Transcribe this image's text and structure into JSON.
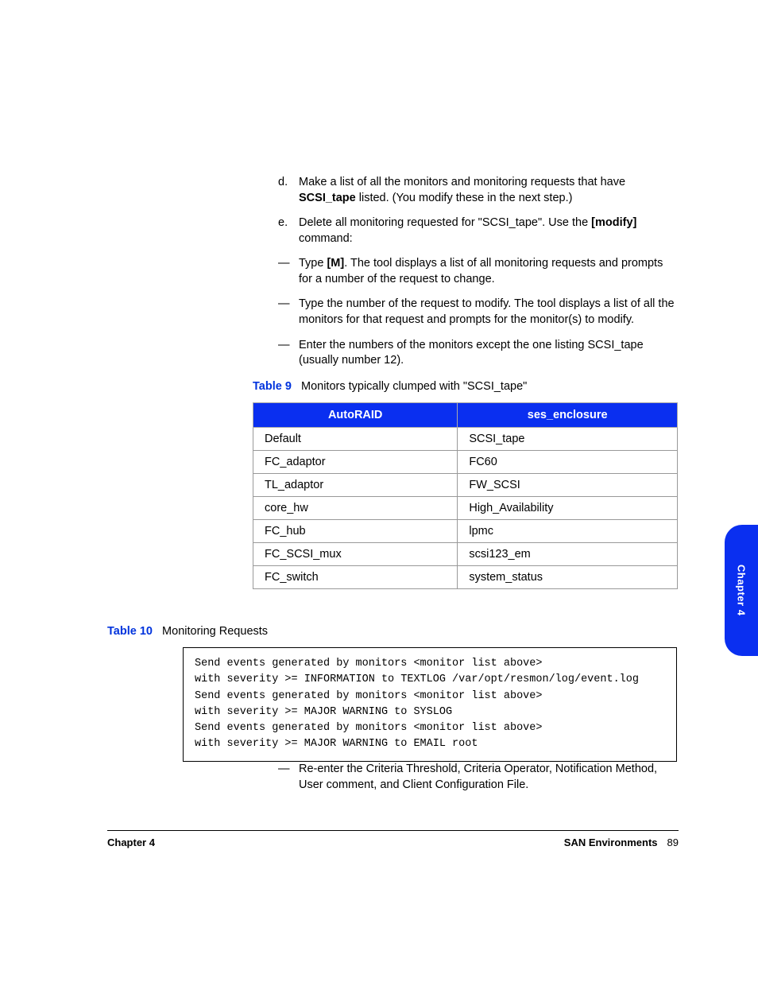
{
  "steps": {
    "d": {
      "marker": "d.",
      "pre": "Make a list of all the monitors and monitoring requests that have ",
      "bold": "SCSI_tape",
      "post": " listed. (You modify these in the next step.)"
    },
    "e": {
      "marker": "e.",
      "pre": "Delete all monitoring requested for \"SCSI_tape\". Use the ",
      "bold": "[modify]",
      "post": " command:"
    },
    "dash1": {
      "marker": "—",
      "pre": "Type ",
      "bold": "[M]",
      "post": ". The tool displays a list of all monitoring requests and prompts for a number of the request to change."
    },
    "dash2": {
      "marker": "—",
      "text": "Type the number of the request to modify. The tool displays a list of all the monitors for that request and prompts for the monitor(s) to modify."
    },
    "dash3": {
      "marker": "—",
      "text": "Enter the numbers of the monitors except the one listing SCSI_tape (usually number 12)."
    }
  },
  "table9": {
    "label": "Table 9",
    "caption": "Monitors typically clumped with \"SCSI_tape\"",
    "headers": [
      "AutoRAID",
      "ses_enclosure"
    ],
    "rows": [
      [
        "Default",
        "SCSI_tape"
      ],
      [
        "FC_adaptor",
        "FC60"
      ],
      [
        "TL_adaptor",
        "FW_SCSI"
      ],
      [
        "core_hw",
        "High_Availability"
      ],
      [
        "FC_hub",
        "lpmc"
      ],
      [
        "FC_SCSI_mux",
        "scsi123_em"
      ],
      [
        "FC_switch",
        "system_status"
      ]
    ]
  },
  "table10": {
    "label": "Table 10",
    "caption": "Monitoring Requests",
    "code": "Send events generated by monitors <monitor list above>\nwith severity >= INFORMATION to TEXTLOG /var/opt/resmon/log/event.log\nSend events generated by monitors <monitor list above>\nwith severity >= MAJOR WARNING to SYSLOG\nSend events generated by monitors <monitor list above>\nwith severity >= MAJOR WARNING to EMAIL root"
  },
  "after": {
    "marker": "—",
    "text": "Re-enter the Criteria Threshold, Criteria Operator, Notification Method, User comment, and Client Configuration File."
  },
  "sidebar": "Chapter 4",
  "footer": {
    "left": "Chapter 4",
    "right": "SAN Environments",
    "page": "89"
  }
}
